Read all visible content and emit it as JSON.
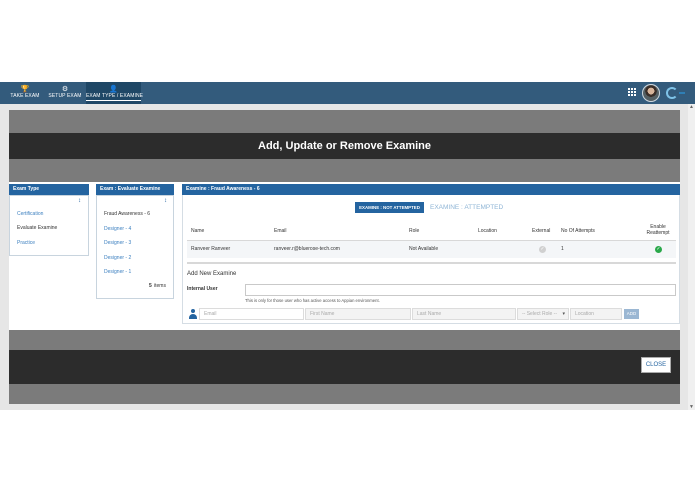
{
  "navbar": {
    "items": [
      {
        "label": "TAKE EXAM",
        "icon": "trophy-icon",
        "glyph": "🏆"
      },
      {
        "label": "SETUP EXAM",
        "icon": "gear-icon",
        "glyph": "⚙"
      },
      {
        "label": "EXAM TYPE / EXAMINE",
        "icon": "user-icon",
        "glyph": "👤"
      }
    ]
  },
  "modal": {
    "title": "Add, Update or Remove Examine",
    "close_label": "CLOSE"
  },
  "exam_type": {
    "header": "Exam Type",
    "items": [
      "Certification",
      "Evaluate Examine",
      "Practice"
    ]
  },
  "exam_list": {
    "header": "Exam : Evaluate Examine",
    "items": [
      "Fraud Awareness - 6",
      "Designer - 4",
      "Designer - 3",
      "Designer - 2",
      "Designer - 1"
    ],
    "count_value": "5",
    "count_suffix": "items"
  },
  "examine": {
    "header": "Examine : Fraud Awareness - 6",
    "tab_not_attempted": "EXAMINE : NOT ATTEMPTED",
    "tab_attempted": "EXAMINE : ATTEMPTED",
    "columns": {
      "name": "Name",
      "email": "Email",
      "role": "Role",
      "location": "Location",
      "external": "External",
      "attempts": "No Of Attempts",
      "reattempt_1": "Enable",
      "reattempt_2": "Reattempt"
    },
    "rows": [
      {
        "name": "Ranveer Ranveer",
        "email": "ranveer.r@bluerose-tech.com",
        "role": "Not Available",
        "location": "",
        "attempts": "1"
      }
    ]
  },
  "add_new": {
    "title": "Add New Examine",
    "internal_label": "Internal User",
    "help_text": "This is only for those user who has active access to Appian environment.",
    "email_placeholder": "Email",
    "first_placeholder": "First Name",
    "last_placeholder": "Last Name",
    "role_placeholder": "-- Select Role --",
    "location_placeholder": "Location",
    "add_label": "ADD"
  }
}
